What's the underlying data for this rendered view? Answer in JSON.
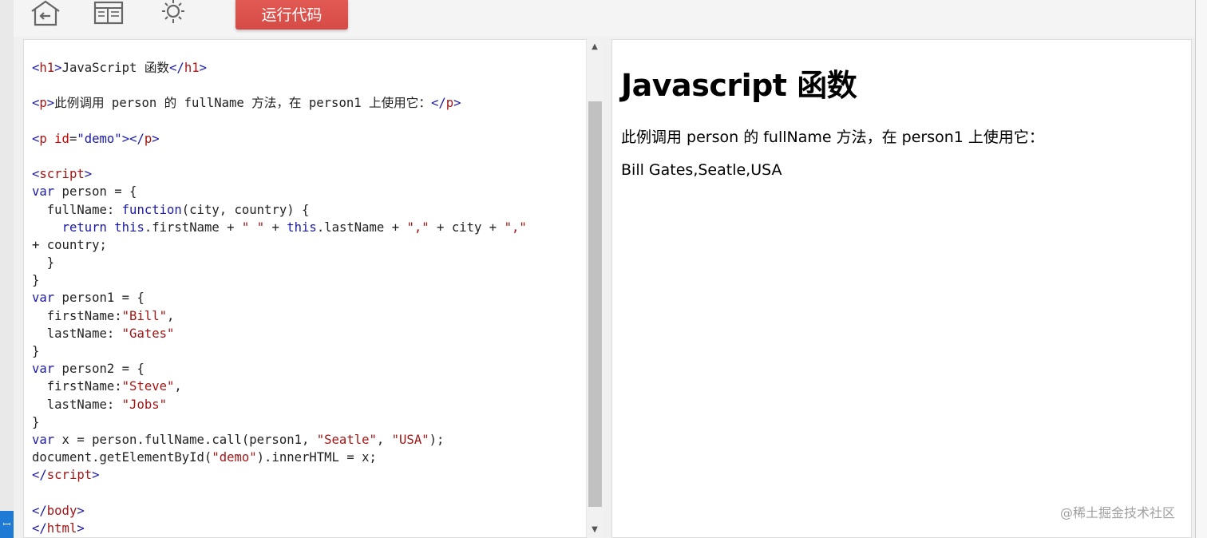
{
  "toolbar": {
    "home_icon": "home-back-icon",
    "layout_icon": "layout-icon",
    "theme_icon": "sun-icon",
    "run_label": "运行代码"
  },
  "editor": {
    "lines": [
      [
        [
          "tag",
          "<"
        ],
        [
          "tname",
          "h1"
        ],
        [
          "tag",
          ">"
        ],
        [
          "txt",
          "JavaScript 函数"
        ],
        [
          "tag",
          "</"
        ],
        [
          "tname",
          "h1"
        ],
        [
          "tag",
          ">"
        ]
      ],
      [],
      [
        [
          "tag",
          "<"
        ],
        [
          "tname",
          "p"
        ],
        [
          "tag",
          ">"
        ],
        [
          "txt",
          "此例调用 person 的 fullName 方法，在 person1 上使用它："
        ],
        [
          "tag",
          "</"
        ],
        [
          "tname",
          "p"
        ],
        [
          "tag",
          ">"
        ]
      ],
      [],
      [
        [
          "tag",
          "<"
        ],
        [
          "tname",
          "p"
        ],
        [
          "txt",
          " "
        ],
        [
          "attr",
          "id"
        ],
        [
          "txt",
          "="
        ],
        [
          "kw",
          "\"demo\""
        ],
        [
          "tag",
          "></"
        ],
        [
          "tname",
          "p"
        ],
        [
          "tag",
          ">"
        ]
      ],
      [],
      [
        [
          "tag",
          "<"
        ],
        [
          "tname",
          "script"
        ],
        [
          "tag",
          ">"
        ]
      ],
      [
        [
          "kw",
          "var"
        ],
        [
          "txt",
          " person = {"
        ]
      ],
      [
        [
          "txt",
          "  fullName: "
        ],
        [
          "kw",
          "function"
        ],
        [
          "txt",
          "(city, country) {"
        ]
      ],
      [
        [
          "txt",
          "    "
        ],
        [
          "kw",
          "return"
        ],
        [
          "txt",
          " "
        ],
        [
          "kw",
          "this"
        ],
        [
          "txt",
          ".firstName + "
        ],
        [
          "str",
          "\" \""
        ],
        [
          "txt",
          " + "
        ],
        [
          "kw",
          "this"
        ],
        [
          "txt",
          ".lastName + "
        ],
        [
          "str",
          "\",\""
        ],
        [
          "txt",
          " + city + "
        ],
        [
          "str",
          "\",\""
        ]
      ],
      [
        [
          "txt",
          "+ country;"
        ]
      ],
      [
        [
          "txt",
          "  }"
        ]
      ],
      [
        [
          "txt",
          "}"
        ]
      ],
      [
        [
          "kw",
          "var"
        ],
        [
          "txt",
          " person1 = {"
        ]
      ],
      [
        [
          "txt",
          "  firstName:"
        ],
        [
          "str",
          "\"Bill\""
        ],
        [
          "txt",
          ","
        ]
      ],
      [
        [
          "txt",
          "  lastName: "
        ],
        [
          "str",
          "\"Gates\""
        ]
      ],
      [
        [
          "txt",
          "}"
        ]
      ],
      [
        [
          "kw",
          "var"
        ],
        [
          "txt",
          " person2 = {"
        ]
      ],
      [
        [
          "txt",
          "  firstName:"
        ],
        [
          "str",
          "\"Steve\""
        ],
        [
          "txt",
          ","
        ]
      ],
      [
        [
          "txt",
          "  lastName: "
        ],
        [
          "str",
          "\"Jobs\""
        ]
      ],
      [
        [
          "txt",
          "}"
        ]
      ],
      [
        [
          "kw",
          "var"
        ],
        [
          "txt",
          " x = person.fullName.call(person1, "
        ],
        [
          "str",
          "\"Seatle\""
        ],
        [
          "txt",
          ", "
        ],
        [
          "str",
          "\"USA\""
        ],
        [
          "txt",
          ");"
        ]
      ],
      [
        [
          "txt",
          "document.getElementById("
        ],
        [
          "str",
          "\"demo\""
        ],
        [
          "txt",
          ").innerHTML = x;"
        ]
      ],
      [
        [
          "tag",
          "</"
        ],
        [
          "tname",
          "script"
        ],
        [
          "tag",
          ">"
        ]
      ],
      [],
      [
        [
          "tag",
          "</"
        ],
        [
          "tname",
          "body"
        ],
        [
          "tag",
          ">"
        ]
      ],
      [
        [
          "tag",
          "</"
        ],
        [
          "tname",
          "html"
        ],
        [
          "tag",
          ">"
        ]
      ]
    ],
    "scroll_up": "▲",
    "scroll_down": "▼"
  },
  "preview": {
    "heading": "Javascript 函数",
    "paragraph": "此例调用 person 的 fullName 方法，在 person1 上使用它：",
    "result": "Bill Gates,Seatle,USA"
  },
  "watermark": "@稀土掘金技术社区",
  "colors": {
    "run_button": "#d64a45",
    "tag": "#1a1aa6",
    "tag_name": "#a31515",
    "keyword": "#1a1aa6",
    "string": "#a31515"
  }
}
